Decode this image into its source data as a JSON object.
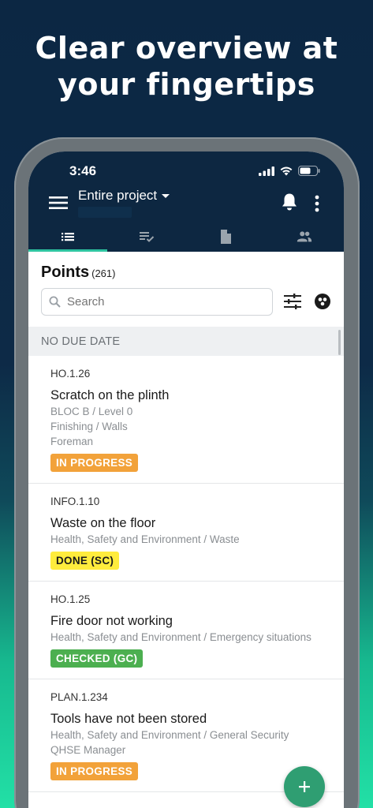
{
  "promo": {
    "line1": "Clear overview at",
    "line2": "your fingertips"
  },
  "status": {
    "time": "3:46"
  },
  "appbar": {
    "title": "Entire project"
  },
  "tabs": [
    {
      "name": "points-list",
      "icon": "list-icon"
    },
    {
      "name": "checklists",
      "icon": "checklist-icon"
    },
    {
      "name": "documents",
      "icon": "document-icon"
    },
    {
      "name": "people",
      "icon": "people-icon"
    }
  ],
  "points": {
    "title": "Points",
    "count": "(261)"
  },
  "search": {
    "placeholder": "Search"
  },
  "section": {
    "label": "NO DUE DATE"
  },
  "items": [
    {
      "code": "HO.1.26",
      "title": "Scratch on the plinth",
      "meta": [
        "BLOC B / Level 0",
        "Finishing / Walls",
        "Foreman"
      ],
      "status": "IN PROGRESS",
      "status_bg": "#f2a23a",
      "status_fg": "#ffffff"
    },
    {
      "code": "INFO.1.10",
      "title": "Waste on the floor",
      "meta": [
        "Health, Safety and Environment / Waste"
      ],
      "status": "DONE (SC)",
      "status_bg": "#ffec3d",
      "status_fg": "#1a1a1a"
    },
    {
      "code": "HO.1.25",
      "title": "Fire door not working",
      "meta": [
        "Health, Safety and Environment / Emergency situations"
      ],
      "status": "CHECKED (GC)",
      "status_bg": "#4caf50",
      "status_fg": "#ffffff"
    },
    {
      "code": "PLAN.1.234",
      "title": "Tools have not been stored",
      "meta": [
        "Health, Safety and Environment / General Security",
        "QHSE Manager"
      ],
      "status": "IN PROGRESS",
      "status_bg": "#f2a23a",
      "status_fg": "#ffffff"
    }
  ],
  "colors": {
    "accent": "#2ec4a0",
    "header": "#0d2741",
    "fab": "#2f9e72"
  }
}
